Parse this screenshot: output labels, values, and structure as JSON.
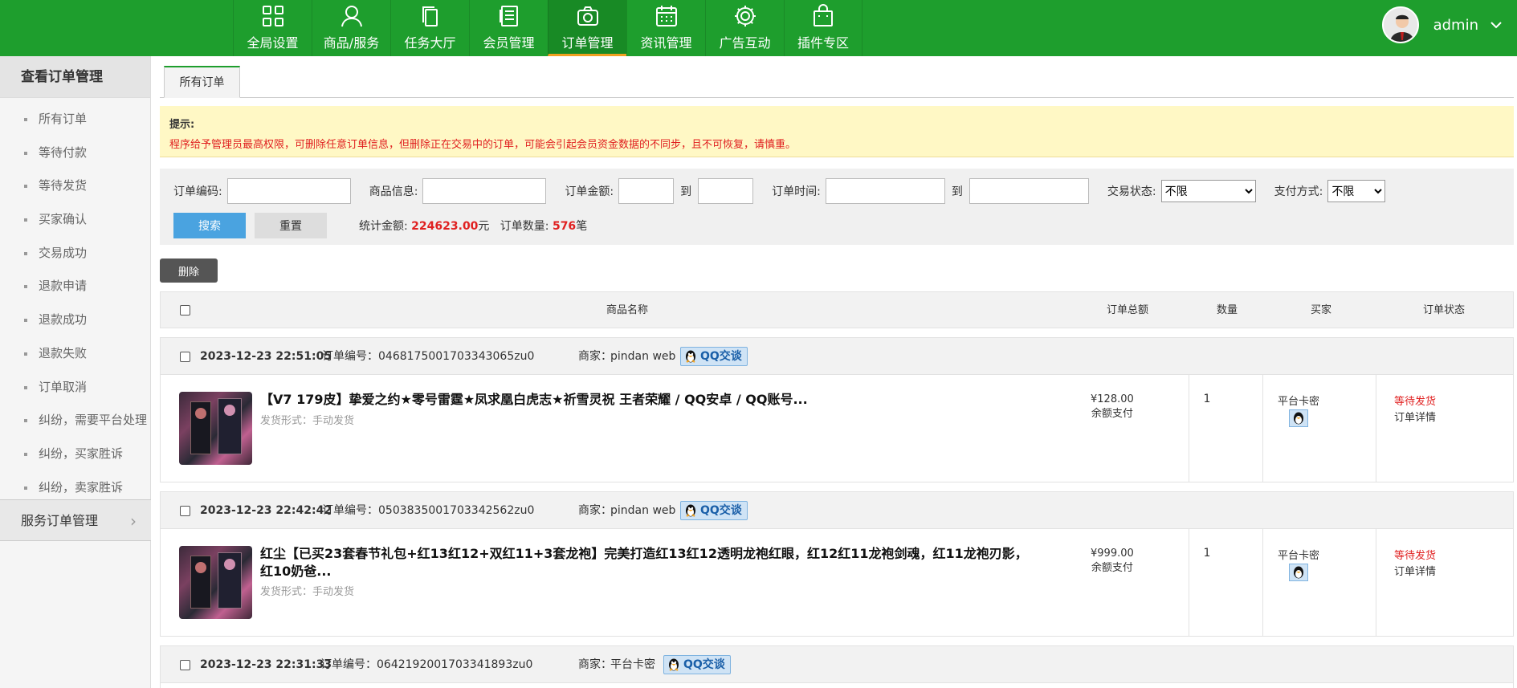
{
  "nav": [
    {
      "label": "全局设置",
      "icon": "grid-icon"
    },
    {
      "label": "商品/服务",
      "icon": "user-icon"
    },
    {
      "label": "任务大厅",
      "icon": "copy-icon"
    },
    {
      "label": "会员管理",
      "icon": "document-icon"
    },
    {
      "label": "订单管理",
      "icon": "camera-icon",
      "active": true
    },
    {
      "label": "资讯管理",
      "icon": "calendar-icon"
    },
    {
      "label": "广告互动",
      "icon": "gear-icon"
    },
    {
      "label": "插件专区",
      "icon": "bag-icon"
    }
  ],
  "user": {
    "name": "admin"
  },
  "sidebar": {
    "title": "查看订单管理",
    "items": [
      "所有订单",
      "等待付款",
      "等待发货",
      "买家确认",
      "交易成功",
      "退款申请",
      "退款成功",
      "退款失败",
      "订单取消",
      "纠纷，需要平台处理",
      "纠纷，买家胜诉",
      "纠纷，卖家胜诉"
    ],
    "footer": "服务订单管理"
  },
  "tab": "所有订单",
  "tip": {
    "title": "提示:",
    "text": "程序给予管理员最高权限，可删除任意订单信息，但删除正在交易中的订单，可能会引起会员资金数据的不同步，且不可恢复，请慎重。"
  },
  "filter": {
    "order_no": "订单编码:",
    "goods": "商品信息:",
    "amount": "订单金额:",
    "to": "到",
    "time": "订单时间:",
    "trade_status": "交易状态:",
    "trade_status_value": "不限",
    "pay_method": "支付方式:",
    "pay_method_value": "不限",
    "search": "搜索",
    "reset": "重置",
    "total_label": "统计金额:",
    "total_value": "224623.00",
    "total_unit": "元",
    "count_label": "订单数量:",
    "count_value": "576",
    "count_unit": "笔"
  },
  "delete": "删除",
  "table_head": {
    "name": "商品名称",
    "total": "订单总额",
    "qty": "数量",
    "buyer": "买家",
    "status": "订单状态"
  },
  "orders": [
    {
      "date": "2023-12-23 22:51:05",
      "order_no": "订单编号：0468175001703343065zu0",
      "merchant_label": "商家：",
      "merchant": "pindan web",
      "qq": "QQ交谈",
      "title": "【V7 179皮】挚爱之约★零号雷霆★凤求凰白虎志★祈雪灵祝 王者荣耀 / QQ安卓 / QQ账号...",
      "ship": "发货形式：手动发货",
      "price": "¥128.00",
      "pay": "余额支付",
      "qty": "1",
      "buyer": "平台卡密",
      "status": "等待发货",
      "detail": "订单详情"
    },
    {
      "date": "2023-12-23 22:42:42",
      "order_no": "订单编号：0503835001703342562zu0",
      "merchant_label": "商家：",
      "merchant": "pindan web",
      "qq": "QQ交谈",
      "title": "红尘【已买23套春节礼包+红13红12+双红11+3套龙袍】完美打造红13红12透明龙袍红眼，红12红11龙袍剑魂，红11龙袍刃影，红10奶爸...",
      "ship": "发货形式：手动发货",
      "price": "¥999.00",
      "pay": "余额支付",
      "qty": "1",
      "buyer": "平台卡密",
      "status": "等待发货",
      "detail": "订单详情"
    },
    {
      "date": "2023-12-23 22:31:33",
      "order_no": "订单编号：0642192001703341893zu0",
      "merchant_label": "商家：",
      "merchant": "平台卡密",
      "qq": "QQ交谈"
    }
  ]
}
